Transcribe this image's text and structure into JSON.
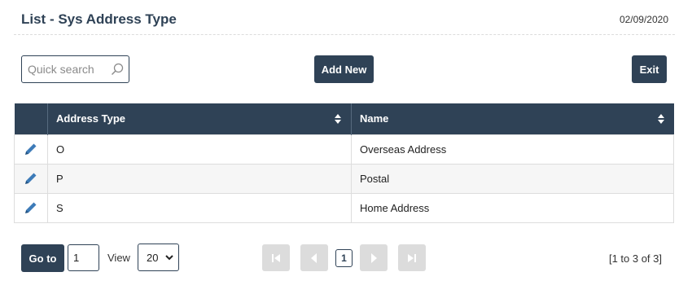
{
  "header": {
    "title": "List - Sys Address Type",
    "date": "02/09/2020"
  },
  "toolbar": {
    "search_placeholder": "Quick search",
    "add_label": "Add New",
    "exit_label": "Exit"
  },
  "table": {
    "columns": [
      "Address Type",
      "Name"
    ],
    "rows": [
      {
        "type": "O",
        "name": "Overseas Address"
      },
      {
        "type": "P",
        "name": "Postal"
      },
      {
        "type": "S",
        "name": "Home Address"
      }
    ]
  },
  "footer": {
    "goto_label": "Go to",
    "goto_value": "1",
    "view_label": "View",
    "view_value": "20",
    "current_page": "1",
    "range_text": "[1 to 3 of 3]"
  },
  "colors": {
    "primary": "#2f4256",
    "disabled": "#dcdcdc",
    "edit_icon": "#3d7bb8"
  }
}
